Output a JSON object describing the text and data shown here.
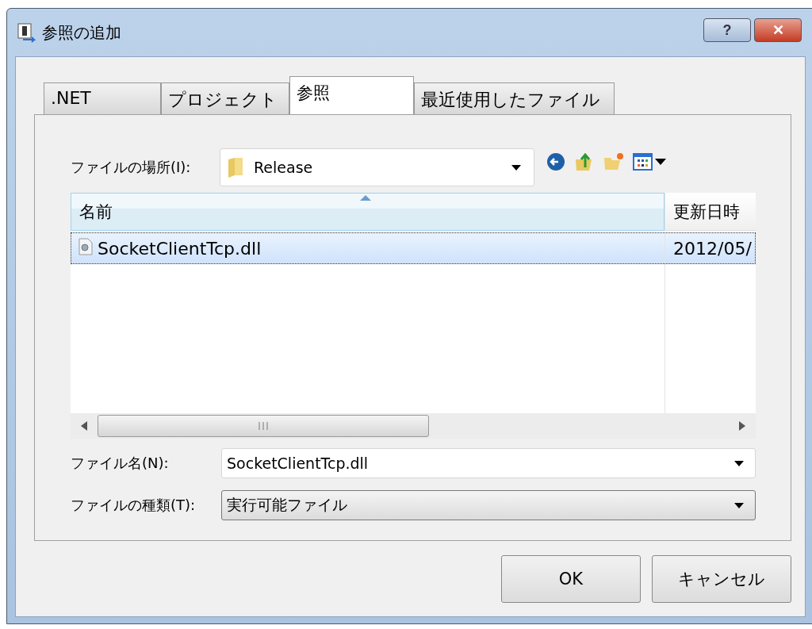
{
  "window": {
    "title": "参照の追加",
    "buttons": [
      {
        "kind": "help",
        "label": "?"
      },
      {
        "kind": "close",
        "label": "✕"
      }
    ]
  },
  "tabs": [
    {
      "label": ".NET",
      "selected": false
    },
    {
      "label": "プロジェクト",
      "selected": false
    },
    {
      "label": "参照",
      "selected": true
    },
    {
      "label": "最近使用したファイル",
      "selected": false
    }
  ],
  "location": {
    "label": "ファイルの場所(I):",
    "value": "Release"
  },
  "file_list": {
    "columns": [
      {
        "label": "名前",
        "sorted": true
      },
      {
        "label": "更新日時",
        "sorted": false
      }
    ],
    "rows": [
      {
        "cells": [
          "SocketClientTcp.dll",
          "2012/05/"
        ],
        "selected": true
      }
    ]
  },
  "file_name": {
    "label": "ファイル名(N):",
    "value": "SocketClientTcp.dll"
  },
  "file_type": {
    "label": "ファイルの種類(T):",
    "value": "実行可能ファイル"
  },
  "buttons": [
    "OK",
    "キャンセル"
  ]
}
